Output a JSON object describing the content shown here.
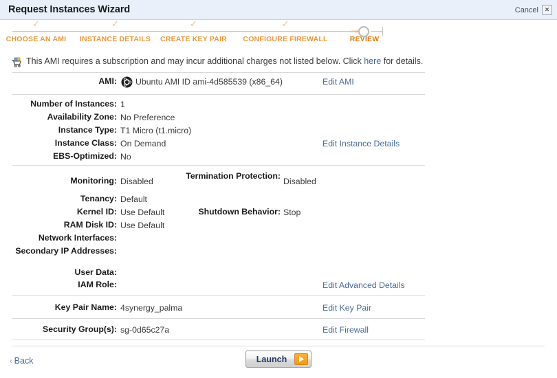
{
  "window": {
    "title": "Request Instances Wizard",
    "cancel_label": "Cancel",
    "close_glyph": "✕"
  },
  "steps": [
    {
      "label": "CHOOSE AN AMI",
      "state": "done",
      "check": "✓"
    },
    {
      "label": "INSTANCE DETAILS",
      "state": "done",
      "check": "✓"
    },
    {
      "label": "CREATE KEY PAIR",
      "state": "done",
      "check": "✓"
    },
    {
      "label": "CONFIGURE FIREWALL",
      "state": "done",
      "check": "✓"
    },
    {
      "label": "REVIEW",
      "state": "current",
      "check": ""
    }
  ],
  "notice": {
    "text_before": "This AMI requires a subscription and may incur additional charges not listed below. Click ",
    "link": "here",
    "text_after": " for details."
  },
  "ami": {
    "label": "AMI:",
    "value": "Ubuntu AMI ID ami-4d585539 (x86_64)",
    "edit_link": "Edit AMI"
  },
  "instance_details": {
    "rows": [
      {
        "label": "Number of Instances:",
        "value": "1"
      },
      {
        "label": "Availability Zone:",
        "value": "No Preference"
      },
      {
        "label": "Instance Type:",
        "value": "T1 Micro (t1.micro)"
      },
      {
        "label": "Instance Class:",
        "value": "On Demand"
      },
      {
        "label": "EBS-Optimized:",
        "value": "No"
      }
    ],
    "edit_link": "Edit Instance Details"
  },
  "advanced_details": {
    "col1": [
      {
        "label": "Monitoring:",
        "value": "Disabled"
      },
      {
        "label": "Tenancy:",
        "value": "Default"
      },
      {
        "label": "Kernel ID:",
        "value": "Use Default"
      },
      {
        "label": "RAM Disk ID:",
        "value": "Use Default"
      },
      {
        "label": "Network Interfaces:",
        "value": ""
      },
      {
        "label": "Secondary IP Addresses:",
        "value": ""
      },
      {
        "label": "User Data:",
        "value": ""
      },
      {
        "label": "IAM Role:",
        "value": ""
      }
    ],
    "col2": [
      {
        "label": "Termination Protection:",
        "value": "Disabled"
      },
      {
        "label": "Shutdown Behavior:",
        "value": "Stop"
      }
    ],
    "edit_link": "Edit Advanced Details"
  },
  "key_pair": {
    "label": "Key Pair Name:",
    "value": "4synergy_palma",
    "edit_link": "Edit Key Pair"
  },
  "security_group": {
    "label": "Security Group(s):",
    "value": "sg-0d65c27a",
    "edit_link": "Edit Firewall"
  },
  "footer": {
    "back_label": "Back",
    "back_chevron": "‹",
    "launch_label": "Launch"
  },
  "colors": {
    "accent_orange": "#e8973a",
    "link_blue": "#4a6b97",
    "titlebar_blue": "#e9f0f9",
    "launch_orange": "#f59a15"
  }
}
